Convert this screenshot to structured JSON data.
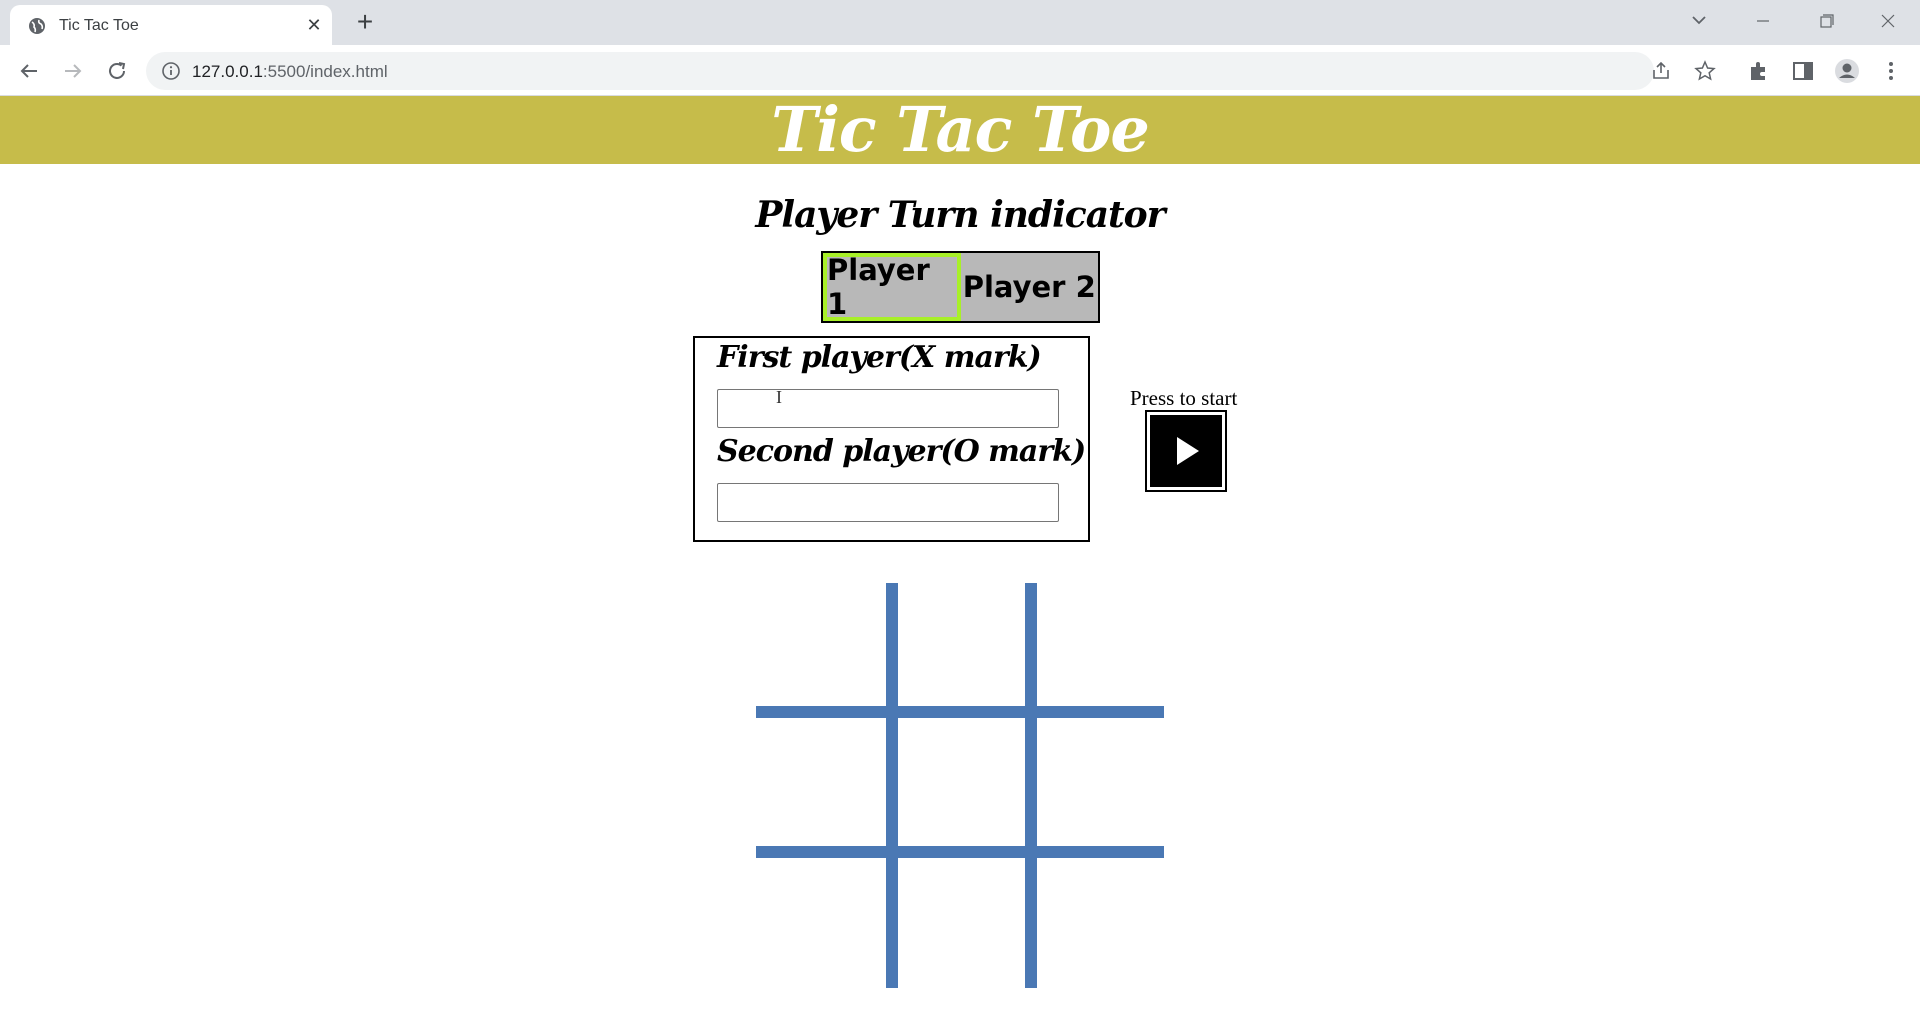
{
  "browser": {
    "tab_title": "Tic Tac Toe",
    "close_glyph": "✕",
    "new_tab_glyph": "+",
    "url_host": "127.0.0.1",
    "url_rest": ":5500/index.html"
  },
  "game": {
    "title": "Tic Tac Toe",
    "turn_indicator_title": "Player Turn indicator",
    "players": [
      {
        "label": "Player 1",
        "active": true
      },
      {
        "label": "Player 2",
        "active": false
      }
    ],
    "first_player_label": "First player(X mark)",
    "first_player_value": "",
    "second_player_label": "Second player(O mark)",
    "second_player_value": "",
    "start_label": "Press to start",
    "board_cells": [
      "",
      "",
      "",
      "",
      "",
      "",
      "",
      "",
      ""
    ]
  },
  "colors": {
    "header_bg": "#c6bc4a",
    "active_player_border": "#a8f028",
    "turn_box_bg": "#b8b8b8",
    "grid_lines": "#4a78b4"
  }
}
